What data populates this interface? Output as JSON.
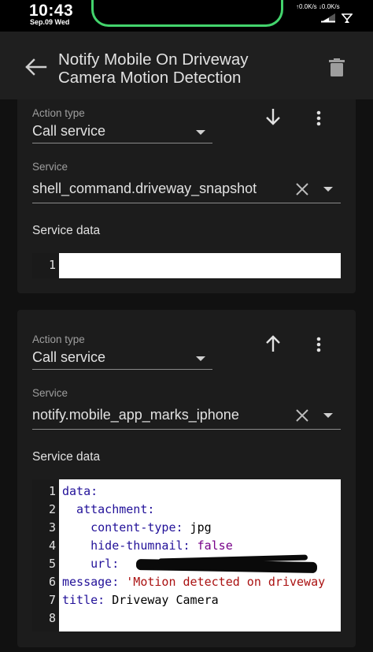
{
  "status_bar": {
    "time": "10:43",
    "date": "Sep.09 Wed",
    "network": "↑0.0K/s ↓0.0K/s"
  },
  "header": {
    "title": "Notify Mobile On Driveway Camera Motion Detection",
    "back_icon": "arrow-left-icon",
    "delete_icon": "trash-icon"
  },
  "actions": [
    {
      "action_type_label": "Action type",
      "action_type": "Call service",
      "service_label": "Service",
      "service": "shell_command.driveway_snapshot",
      "service_data_label": "Service data",
      "move_icon": "arrow-down-icon",
      "code_lines": [
        "1"
      ],
      "code": ""
    },
    {
      "action_type_label": "Action type",
      "action_type": "Call service",
      "service_label": "Service",
      "service": "notify.mobile_app_marks_iphone",
      "service_data_label": "Service data",
      "move_icon": "arrow-up-icon",
      "code_lines": [
        "1",
        "2",
        "3",
        "4",
        "5",
        "6",
        "7",
        "8"
      ],
      "code": {
        "l1_key": "data:",
        "l2_key": "  attachment:",
        "l3_key": "    content-type:",
        "l3_val": " jpg",
        "l4_key": "    hide-thumnail:",
        "l4_val": " false",
        "l5_key": "    url:",
        "l6_key": "message:",
        "l6_val": " 'Motion detected on driveway",
        "l7_key": "title:",
        "l7_val": " Driveway Camera"
      }
    }
  ],
  "colors": {
    "background": "#111111",
    "card": "#1c1c1c",
    "header": "#1f1f1f",
    "notch": "#43d36c"
  }
}
